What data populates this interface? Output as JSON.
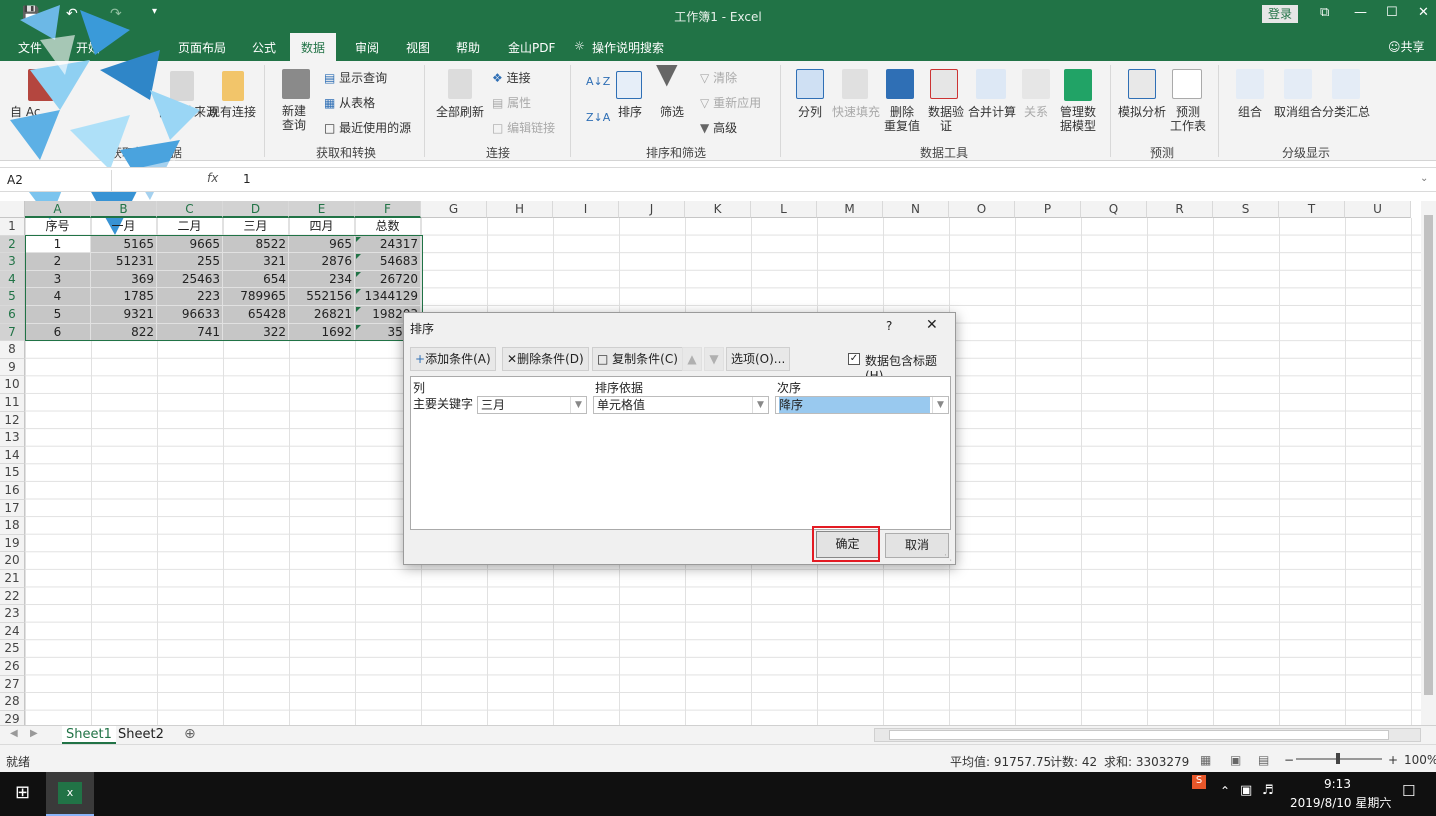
{
  "titlebar": {
    "title": "工作簿1 - Excel",
    "login": "登录",
    "min": "—",
    "max": "☐",
    "close": "✕",
    "restore": "⧉"
  },
  "tabs": [
    "文件",
    "开始",
    "页面布局",
    "公式",
    "数据",
    "审阅",
    "视图",
    "帮助",
    "金山PDF",
    "操作说明搜索"
  ],
  "share": "共享",
  "ribbon": {
    "get_external": {
      "access": "自 Ac",
      "other": "自其他来源",
      "existing": "现有连接",
      "label": "获取外部数据"
    },
    "transform": {
      "new_query_line1": "新建",
      "new_query_line2": "查询",
      "show_query": "显示查询",
      "from_table": "从表格",
      "recent": "最近使用的源",
      "label": "获取和转换"
    },
    "connections": {
      "refresh_all": "全部刷新",
      "connections": "连接",
      "properties": "属性",
      "edit_links": "编辑链接",
      "label": "连接"
    },
    "sort_filter": {
      "sort": "排序",
      "filter": "筛选",
      "clear": "清除",
      "reapply": "重新应用",
      "advanced": "高级",
      "label": "排序和筛选"
    },
    "data_tools": {
      "text_to_col": "分列",
      "flash_fill": "快速填充",
      "remove_dup_1": "删除",
      "remove_dup_2": "重复值",
      "validation_1": "数据验",
      "validation_2": "证",
      "consolidate": "合并计算",
      "relationships": "关系",
      "data_model_1": "管理数",
      "data_model_2": "据模型",
      "label": "数据工具"
    },
    "forecast": {
      "what_if": "模拟分析",
      "forecast_1": "预测",
      "forecast_2": "工作表",
      "label": "预测"
    },
    "outline": {
      "group": "组合",
      "ungroup": "取消组合",
      "subtotal": "分类汇总",
      "label": "分级显示"
    }
  },
  "formula_bar": {
    "name_box": "A2",
    "fx": "fx",
    "value": "1"
  },
  "columns": [
    "A",
    "B",
    "C",
    "D",
    "E",
    "F",
    "G",
    "H",
    "I",
    "J",
    "K",
    "L",
    "M",
    "N",
    "O",
    "P",
    "Q",
    "R",
    "S",
    "T",
    "U"
  ],
  "rows": [
    "1",
    "2",
    "3",
    "4",
    "5",
    "6",
    "7",
    "8",
    "9",
    "10",
    "11",
    "12",
    "13",
    "14",
    "15",
    "16",
    "17",
    "18",
    "19",
    "20",
    "21",
    "22",
    "23",
    "24",
    "25",
    "26",
    "27",
    "28",
    "29"
  ],
  "sheet": {
    "header": [
      "序号",
      "一月",
      "二月",
      "三月",
      "四月",
      "总数"
    ],
    "data": [
      [
        "1",
        "5165",
        "9665",
        "8522",
        "965",
        "24317"
      ],
      [
        "2",
        "51231",
        "255",
        "321",
        "2876",
        "54683"
      ],
      [
        "3",
        "369",
        "25463",
        "654",
        "234",
        "26720"
      ],
      [
        "4",
        "1785",
        "223",
        "789965",
        "552156",
        "1344129"
      ],
      [
        "5",
        "9321",
        "96633",
        "65428",
        "26821",
        "198203"
      ],
      [
        "6",
        "822",
        "741",
        "322",
        "1692",
        "3577"
      ]
    ]
  },
  "sheet_tabs": [
    "Sheet1",
    "Sheet2"
  ],
  "status": {
    "ready": "就绪",
    "average": "平均值: 91757.75",
    "count": "计数: 42",
    "sum": "求和: 3303279",
    "zoom": "100%"
  },
  "taskbar": {
    "time": "9:13",
    "date": "2019/8/10 星期六"
  },
  "dialog": {
    "title": "排序",
    "help": "?",
    "close": "✕",
    "add": "添加条件(A)",
    "delete": "删除条件(D)",
    "copy": "复制条件(C)",
    "options": "选项(O)...",
    "has_header": "数据包含标题(H)",
    "col_header": "列",
    "sorton_header": "排序依据",
    "order_header": "次序",
    "row_label": "主要关键字",
    "column_value": "三月",
    "sorton_value": "单元格值",
    "order_value": "降序",
    "ok": "确定",
    "cancel": "取消"
  },
  "colors": {
    "excel_green": "#217346",
    "highlight_red": "#e31b23"
  }
}
